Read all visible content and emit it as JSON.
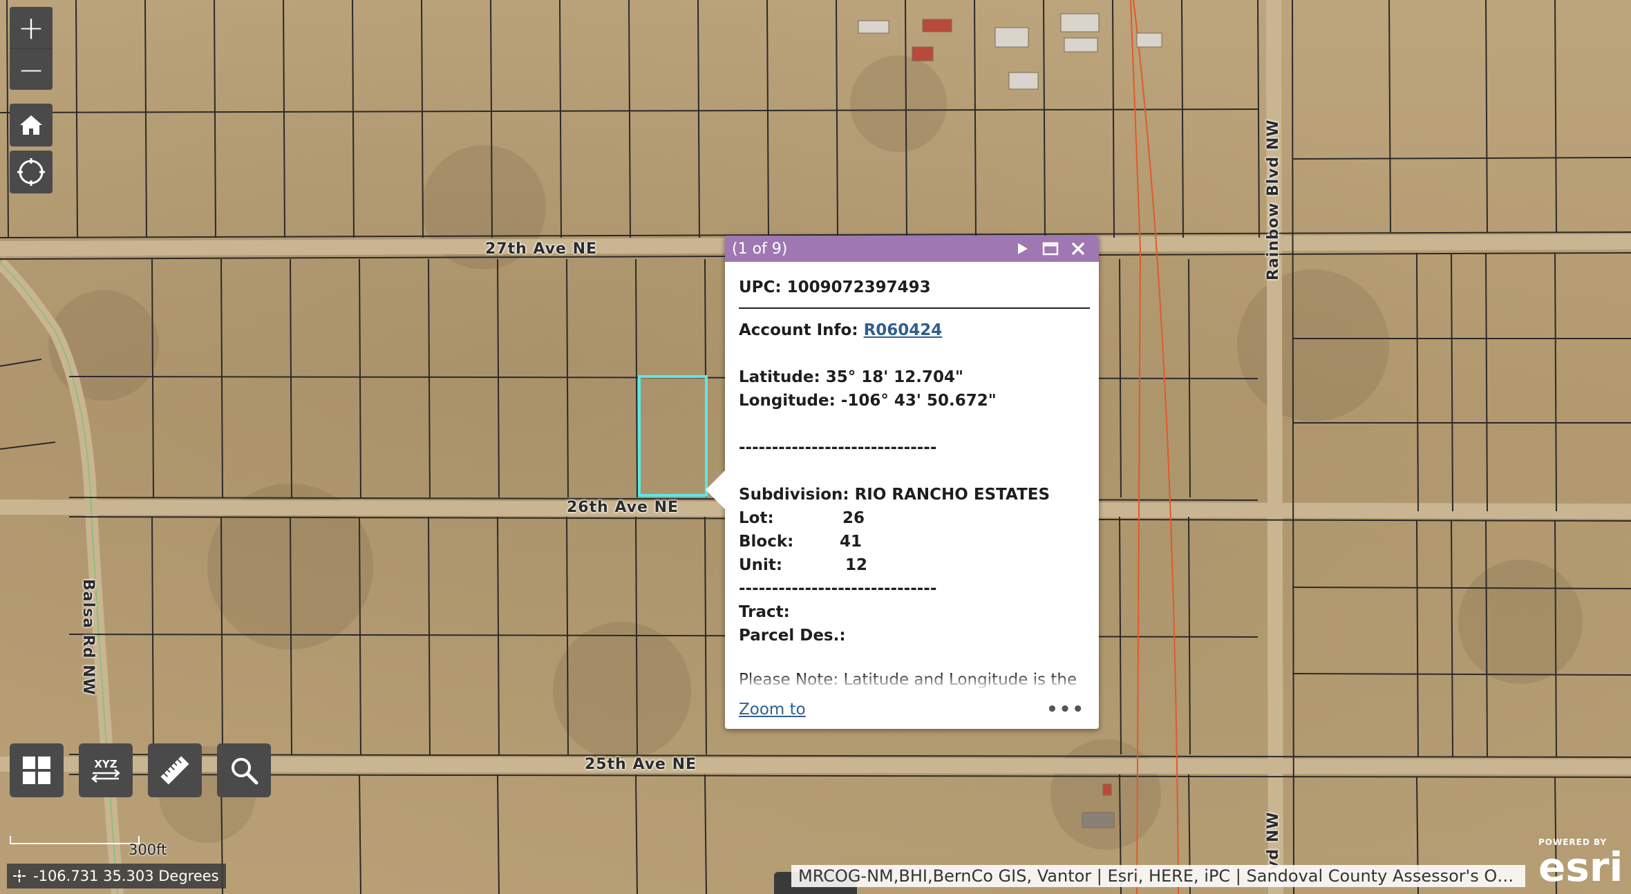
{
  "map": {
    "roads": {
      "ave27": "27th Ave NE",
      "ave26": "26th Ave NE",
      "ave25": "25th Ave NE",
      "rainbow_upper": "Rainbow Blvd NW",
      "rainbow_lower": "vd NW",
      "balsa": "Balsa Rd NW"
    },
    "colors": {
      "selection": "#5ee6e6",
      "popup_header": "#9f77b2",
      "power_line": "#e05a2a",
      "parcel_line": "#2a2a2a"
    }
  },
  "controls": {
    "zoom_in": "+",
    "zoom_out": "−",
    "home_icon": "home-icon",
    "locate_icon": "locate-icon",
    "tools": [
      "basemap-gallery-icon",
      "xyz-coordinate-icon",
      "measure-ruler-icon",
      "search-icon"
    ],
    "xyz_label": "XYZ"
  },
  "popup": {
    "count": "(1 of 9)",
    "upc_label": "UPC:",
    "upc_value": "1009072397493",
    "account_label": "Account Info:",
    "account_value": "R060424",
    "lat_label": "Latitude:",
    "lat_value": "35° 18' 12.704\"",
    "lon_label": "Longitude:",
    "lon_value": "-106° 43' 50.672\"",
    "divider": "------------------------------",
    "subdivision_label": "Subdivision:",
    "subdivision_value": "RIO RANCHO ESTATES",
    "lot_label": "Lot:",
    "lot_value": "26",
    "block_label": "Block:",
    "block_value": "41",
    "unit_label": "Unit:",
    "unit_value": "12",
    "tract_label": "Tract:",
    "parcel_des_label": "Parcel Des.:",
    "note": "Please Note: Latitude and Longitude is the approximate center of the parcel shown.",
    "zoom_to": "Zoom to",
    "more": "•••"
  },
  "footer": {
    "scale": "300ft",
    "coords": "-106.731 35.303 Degrees",
    "attribution": "MRCOG-NM,BHI,BernCo GIS, Vantor | Esri, HERE, iPC | Sandoval County Assessor's Off...",
    "powered_by": "POWERED BY",
    "esri": "esri"
  }
}
